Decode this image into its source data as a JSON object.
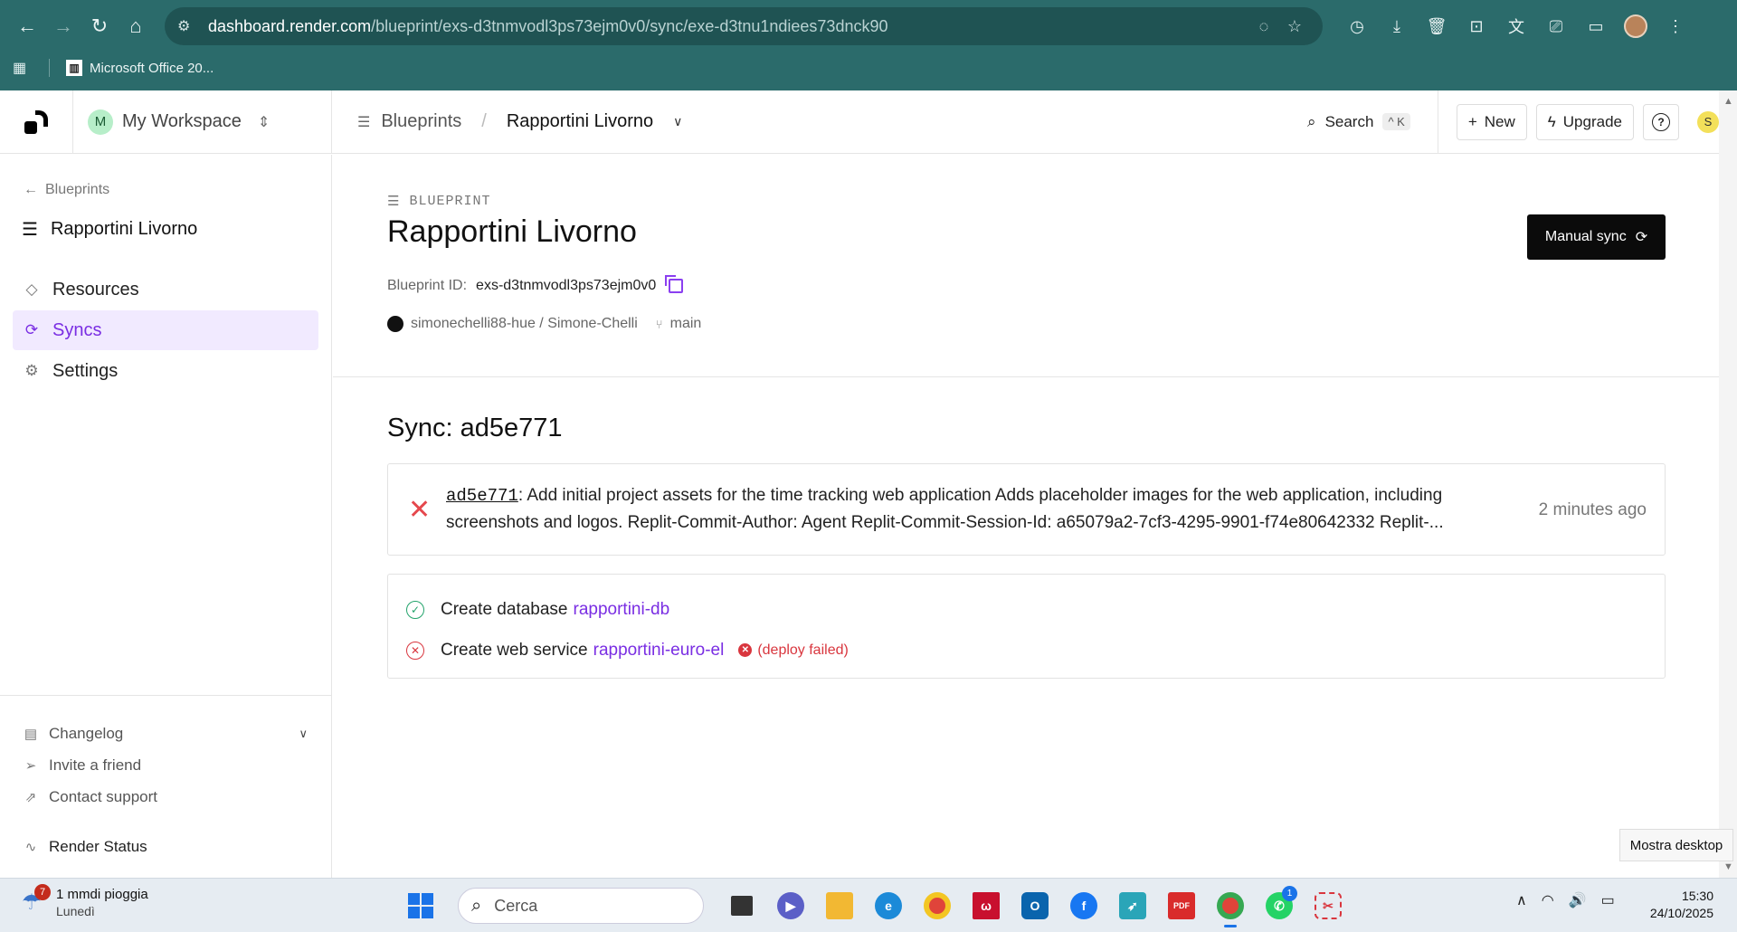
{
  "browser": {
    "url_host": "dashboard.render.com",
    "url_path": "/blueprint/exs-d3tnmvodl3ps73ejm0v0/sync/exe-d3tnu1ndiees73dnck90",
    "bookmark": "Microsoft Office 20..."
  },
  "header": {
    "workspace_initial": "M",
    "workspace_name": "My Workspace",
    "crumb_parent": "Blueprints",
    "crumb_current": "Rapportini Livorno",
    "search_label": "Search",
    "search_kbd": "^ K",
    "new_label": "New",
    "upgrade_label": "Upgrade",
    "user_initial": "S"
  },
  "sidebar": {
    "back_label": "Blueprints",
    "title": "Rapportini Livorno",
    "items": [
      {
        "label": "Resources",
        "icon": "diamond-icon",
        "active": false
      },
      {
        "label": "Syncs",
        "icon": "sync-icon",
        "active": true
      },
      {
        "label": "Settings",
        "icon": "gear-icon",
        "active": false
      }
    ],
    "bottom": {
      "changelog": "Changelog",
      "invite": "Invite a friend",
      "support": "Contact support",
      "status": "Render Status"
    }
  },
  "blueprint": {
    "kicker": "BLUEPRINT",
    "title": "Rapportini Livorno",
    "id_label": "Blueprint ID:",
    "id_value": "exs-d3tnmvodl3ps73ejm0v0",
    "repo": "simonechelli88-hue / Simone-Chelli",
    "branch": "main",
    "manual_sync_label": "Manual sync"
  },
  "sync": {
    "title": "Sync: ad5e771",
    "commit_hash": "ad5e771",
    "commit_message": ": Add initial project assets for the time tracking web application Adds placeholder images for the web application, including screenshots and logos. Replit-Commit-Author: Agent Replit-Commit-Session-Id: a65079a2-7cf3-4295-9901-f74e80642332 Replit-...",
    "commit_time": "2 minutes ago",
    "actions": [
      {
        "text": "Create database",
        "link": "rapportini-db",
        "status": "ok",
        "note": ""
      },
      {
        "text": "Create web service",
        "link": "rapportini-euro-el",
        "status": "error",
        "note": "(deploy failed)"
      }
    ]
  },
  "tooltip": "Mostra desktop",
  "taskbar": {
    "weather_badge": "7",
    "weather_line1": "1 mmdi pioggia",
    "weather_line2": "Lunedì",
    "search_placeholder": "Cerca",
    "whatsapp_badge": "1",
    "time": "15:30",
    "date": "24/10/2025"
  },
  "colors": {
    "chrome": "#2b6b6b",
    "accent": "#7a2ee3",
    "error": "#d9363e",
    "success": "#23a36b"
  }
}
